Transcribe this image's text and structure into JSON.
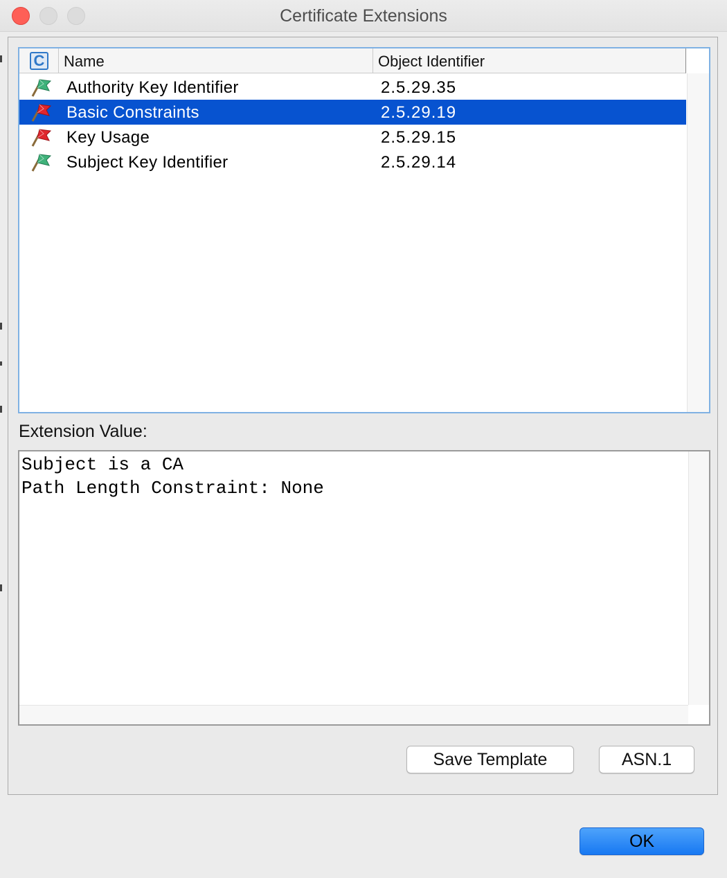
{
  "window": {
    "title": "Certificate Extensions"
  },
  "table": {
    "columns": {
      "icon": "C",
      "name": "Name",
      "oid": "Object Identifier"
    },
    "rows": [
      {
        "name": "Authority Key Identifier",
        "oid": "2.5.29.35",
        "flag": "green",
        "selected": false
      },
      {
        "name": "Basic Constraints",
        "oid": "2.5.29.19",
        "flag": "red",
        "selected": true
      },
      {
        "name": "Key Usage",
        "oid": "2.5.29.15",
        "flag": "red",
        "selected": false
      },
      {
        "name": "Subject Key Identifier",
        "oid": "2.5.29.14",
        "flag": "green",
        "selected": false
      }
    ]
  },
  "extension": {
    "label": "Extension Value:",
    "lines": [
      "Subject is a CA",
      "Path Length Constraint: None"
    ]
  },
  "buttons": {
    "save_template": "Save Template",
    "asn1": "ASN.1",
    "ok": "OK"
  },
  "colors": {
    "selection": "#0753d0",
    "flag_critical": "#e0262d",
    "flag_noncritical": "#3fb27a",
    "ok_button": "#1778f2"
  }
}
